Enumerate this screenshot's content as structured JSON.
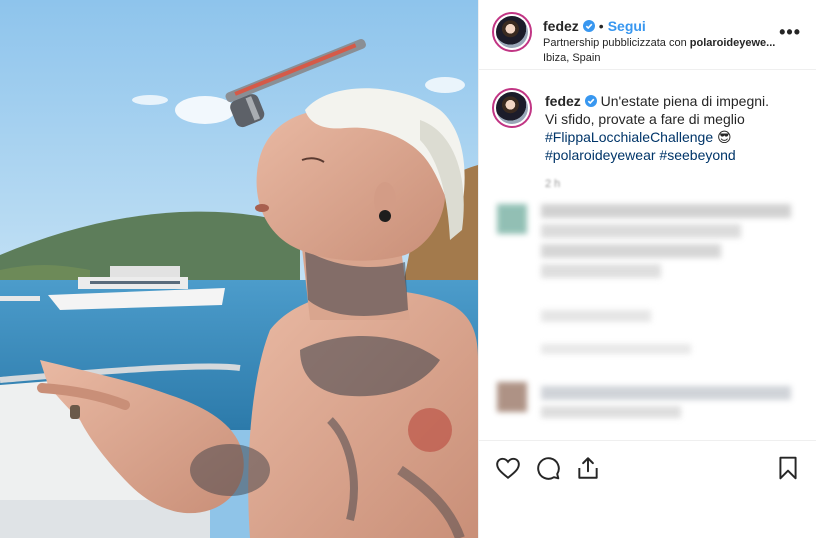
{
  "post": {
    "username": "fedez",
    "follow_label": "Segui",
    "separator": "•",
    "partnership_prefix": "Partnership pubblicizzata con ",
    "partner": "polaroideyewe...",
    "location": "Ibiza, Spain",
    "more_label": "•••"
  },
  "caption": {
    "username": "fedez",
    "text_line1": " Un'estate piena di impegni.",
    "text_line2": "Vi sfido, provate a fare di meglio",
    "hashtag1": "#FlippaLocchialeChallenge",
    "emoji": " 😎",
    "hashtag2": "#polaroideyewear",
    "hashtag3": " #seebeyond",
    "time": "2 h"
  },
  "icons": {
    "verified": "verified-badge-icon",
    "like": "heart-icon",
    "comment": "comment-icon",
    "share": "share-icon",
    "save": "bookmark-icon",
    "more": "more-options-icon"
  },
  "colors": {
    "link": "#3897f0",
    "hashtag": "#003569",
    "avatar_ring": "#c13584",
    "verified": "#3897f0"
  }
}
